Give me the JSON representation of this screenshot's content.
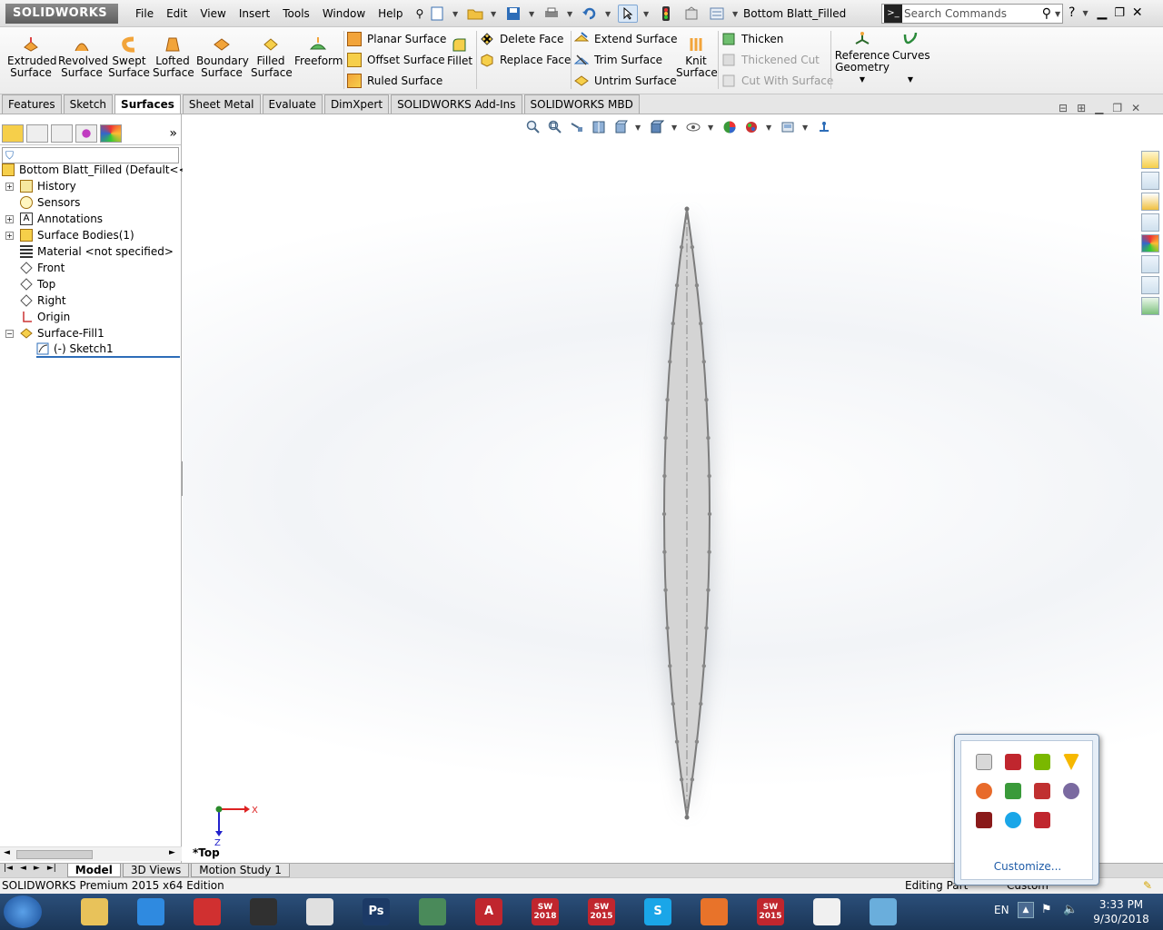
{
  "titlebar": {
    "logo": "SOLIDWORKS",
    "menus": [
      "File",
      "Edit",
      "View",
      "Insert",
      "Tools",
      "Window",
      "Help"
    ],
    "doc_title": "Bottom Blatt_Filled",
    "search_placeholder": "Search Commands"
  },
  "command_manager": {
    "big_buttons": [
      {
        "label": "Extruded Surface",
        "icon": "extruded-surface-icon"
      },
      {
        "label": "Revolved Surface",
        "icon": "revolved-surface-icon"
      },
      {
        "label": "Swept Surface",
        "icon": "swept-surface-icon"
      },
      {
        "label": "Lofted Surface",
        "icon": "lofted-surface-icon"
      },
      {
        "label": "Boundary Surface",
        "icon": "boundary-surface-icon"
      },
      {
        "label": "Filled Surface",
        "icon": "filled-surface-icon"
      },
      {
        "label": "Freeform",
        "icon": "freeform-icon"
      }
    ],
    "group1": [
      "Planar Surface",
      "Offset Surface",
      "Ruled Surface"
    ],
    "fillet": "Fillet",
    "group2": [
      "Delete Face",
      "Replace Face"
    ],
    "group3": [
      "Extend Surface",
      "Trim Surface",
      "Untrim Surface"
    ],
    "knit": "Knit Surface",
    "group4": [
      {
        "label": "Thicken",
        "enabled": true
      },
      {
        "label": "Thickened Cut",
        "enabled": false
      },
      {
        "label": "Cut With Surface",
        "enabled": false
      }
    ],
    "reference_geometry": "Reference Geometry",
    "curves": "Curves"
  },
  "tabs": [
    "Features",
    "Sketch",
    "Surfaces",
    "Sheet Metal",
    "Evaluate",
    "DimXpert",
    "SOLIDWORKS Add-Ins",
    "SOLIDWORKS MBD"
  ],
  "active_tab": "Surfaces",
  "feature_tree": {
    "root": "Bottom Blatt_Filled  (Default<<De",
    "items": [
      {
        "label": "History",
        "icon": "history-icon"
      },
      {
        "label": "Sensors",
        "icon": "sensors-icon"
      },
      {
        "label": "Annotations",
        "icon": "annotations-icon"
      },
      {
        "label": "Surface Bodies(1)",
        "icon": "surface-bodies-icon"
      },
      {
        "label": "Material <not specified>",
        "icon": "material-icon"
      },
      {
        "label": "Front",
        "icon": "plane-icon"
      },
      {
        "label": "Top",
        "icon": "plane-icon"
      },
      {
        "label": "Right",
        "icon": "plane-icon"
      },
      {
        "label": "Origin",
        "icon": "origin-icon"
      },
      {
        "label": "Surface-Fill1",
        "icon": "surface-fill-icon"
      },
      {
        "label": "(-) Sketch1",
        "icon": "sketch-icon"
      }
    ]
  },
  "viewport": {
    "view_label": "*Top",
    "triad": {
      "x": "X",
      "z": "Z"
    }
  },
  "bottom_tabs": [
    "Model",
    "3D Views",
    "Motion Study 1"
  ],
  "active_bottom_tab": "Model",
  "statusbar": {
    "left": "SOLIDWORKS Premium 2015 x64 Edition",
    "right": "Editing Part",
    "custom": "Custom"
  },
  "taskbar": {
    "apps": [
      {
        "name": "file-explorer",
        "color": "#e8c25a"
      },
      {
        "name": "internet-explorer",
        "color": "#2f8ae0"
      },
      {
        "name": "downloader",
        "color": "#d03030"
      },
      {
        "name": "obs",
        "color": "#303030"
      },
      {
        "name": "unity",
        "color": "#e0e0e0"
      },
      {
        "name": "photoshop",
        "color": "#1c3a66",
        "label": "Ps"
      },
      {
        "name": "globe-app",
        "color": "#4a8a5a"
      },
      {
        "name": "autocad",
        "color": "#c0262e",
        "label": "A"
      },
      {
        "name": "solidworks-2018",
        "color": "#c0262e",
        "label": "SW\n2018"
      },
      {
        "name": "solidworks-2015",
        "color": "#c0262e",
        "label": "SW\n2015"
      },
      {
        "name": "skype",
        "color": "#1aa6e8",
        "label": "S"
      },
      {
        "name": "firefox",
        "color": "#e8732a"
      },
      {
        "name": "solidworks-2015-active",
        "color": "#c0262e",
        "label": "SW\n2015"
      },
      {
        "name": "notepad-app",
        "color": "#f0f0f0"
      },
      {
        "name": "onenote-app",
        "color": "#6aaedc"
      }
    ],
    "lang": "EN",
    "time": "3:33 PM",
    "date": "9/30/2018"
  },
  "tray_overflow": {
    "customize": "Customize..."
  },
  "colors": {
    "accent": "#1f5ca8",
    "taskbar": "#1b3657",
    "model_face": "#d4d4d4"
  }
}
